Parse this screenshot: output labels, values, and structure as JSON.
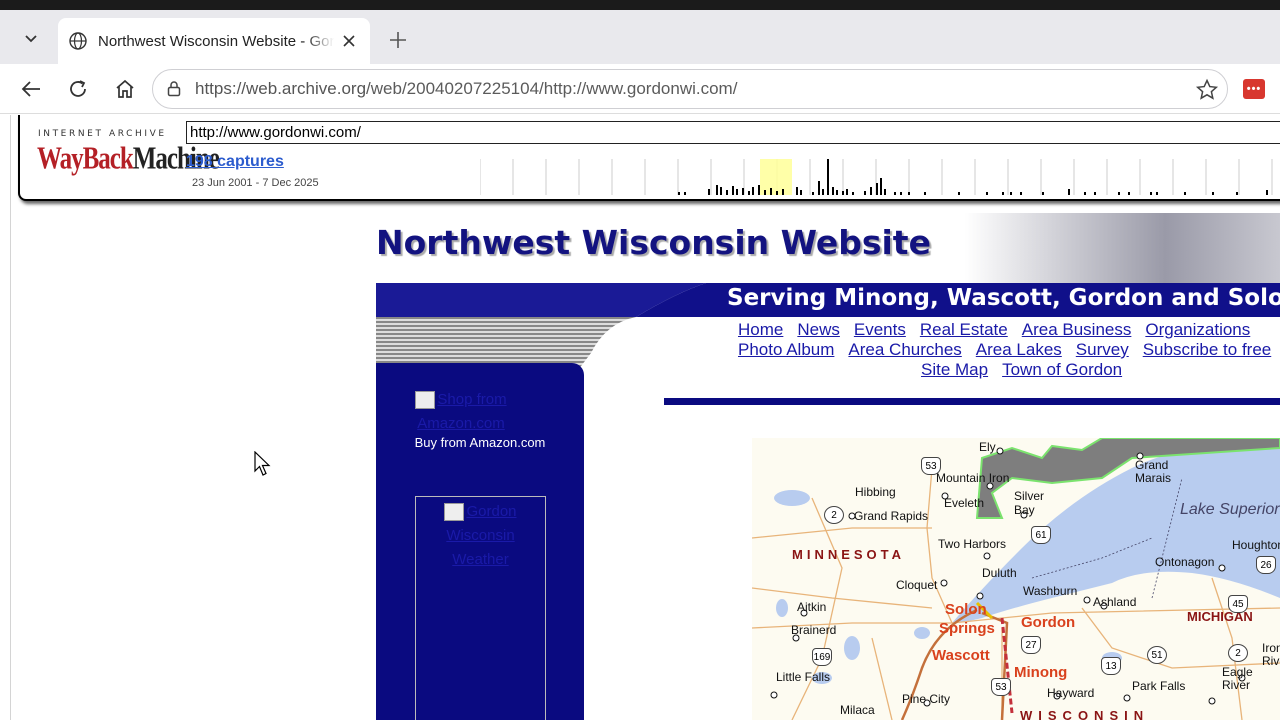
{
  "browser": {
    "tab_title": "Northwest Wisconsin Website - Gordon",
    "url_scheme_host": "https://web.archive.org",
    "url_path": "/web/20040207225104/http://www.gordonwi.com/",
    "ext_label": "•••"
  },
  "wayback": {
    "logo_top": "INTERNET ARCHIVE",
    "logo_word1": "WayBack",
    "logo_word2": "Machine",
    "url_value": "http://www.gordonwi.com/",
    "captures": "198 captures",
    "range": "23 Jun 2001 - 7 Dec 2025"
  },
  "site": {
    "title": "Northwest Wisconsin Website",
    "banner": "Serving Minong, Wascott, Gordon and Solon",
    "nav_row1": [
      "Home",
      "News",
      "Events",
      "Real Estate",
      "Area Business",
      "Organizations"
    ],
    "nav_row2": [
      "Photo Album",
      "Area Churches",
      "Area Lakes",
      "Survey",
      "Subscribe to free"
    ],
    "nav_row3": [
      "Site Map",
      "Town of Gordon"
    ],
    "amazon_alt": "Shop from Amazon.com",
    "amazon_caption": "Buy from Amazon.com",
    "weather_alt": "Gordon Wisconsin Weather"
  },
  "map": {
    "lake": "Lake Superior",
    "states": {
      "mn": "MINNESOTA",
      "mi": "MICHIGAN",
      "wi": "WISCONSIN"
    },
    "cities": [
      "Ely",
      "Mountain Iron",
      "Grand Marais",
      "Hibbing",
      "Eveleth",
      "Silver Bay",
      "Grand Rapids",
      "Two Harbors",
      "Houghton",
      "Duluth",
      "Ontonagon",
      "Cloquet",
      "Washburn",
      "Ashland",
      "Aitkin",
      "Brainerd",
      "Little Falls",
      "Pine City",
      "Milaca",
      "Hayward",
      "Park Falls",
      "Eagle River",
      "Iron River"
    ],
    "highlight": {
      "solon": "Solon",
      "springs": "Springs",
      "gordon": "Gordon",
      "wascott": "Wascott",
      "minong": "Minong"
    },
    "shields": [
      "53",
      "2",
      "61",
      "26",
      "45",
      "27",
      "13",
      "51",
      "2",
      "169",
      "53"
    ]
  }
}
